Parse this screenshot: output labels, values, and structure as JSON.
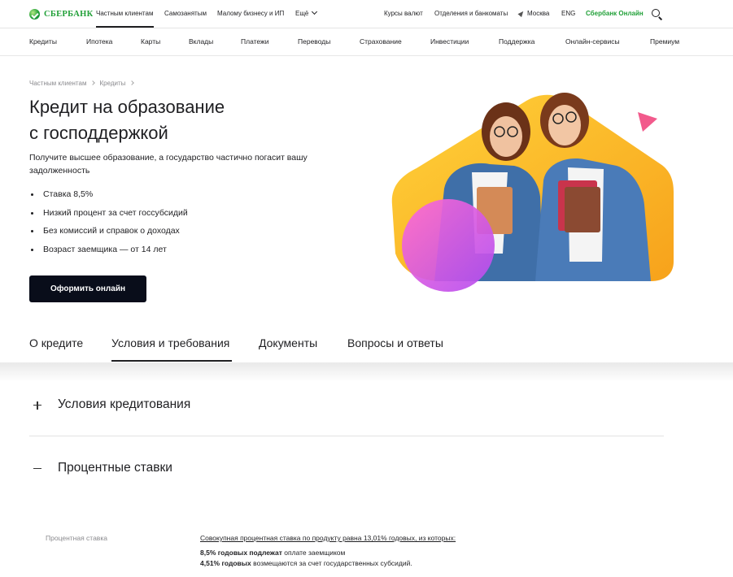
{
  "header": {
    "logo": "СБЕРБАНК",
    "segments": [
      "Частным клиентам",
      "Самозанятым",
      "Малому бизнесу и ИП",
      "Ещё"
    ],
    "links": [
      "Курсы валют",
      "Отделения и банкоматы",
      "Москва",
      "ENG",
      "Сбербанк Онлайн"
    ],
    "accent": "#21a038"
  },
  "subnav": [
    "Кредиты",
    "Ипотека",
    "Карты",
    "Вклады",
    "Платежи",
    "Переводы",
    "Страхование",
    "Инвестиции",
    "Поддержка",
    "Онлайн-сервисы",
    "Премиум"
  ],
  "breadcrumbs": [
    "Частным клиентам",
    "Кредиты"
  ],
  "hero": {
    "title_line1": "Кредит на образование",
    "title_line2": "с господдержкой",
    "lead": "Получите высшее образование, а государство частично погасит вашу задолженность",
    "bullets": [
      "Ставка 8,5%",
      "Низкий процент за счет госсубсидий",
      "Без комиссий и справок о доходах",
      "Возраст заемщика — от 14 лет"
    ],
    "cta": "Оформить онлайн"
  },
  "tabs": [
    "О кредите",
    "Условия и требования",
    "Документы",
    "Вопросы и ответы"
  ],
  "accordion": {
    "section1": "Условия кредитования",
    "section2": "Процентные ставки"
  },
  "rates": {
    "label": "Процентная ставка",
    "summary": "Совокупная процентная ставка по продукту  равна 13,01% годовых, из которых:",
    "line1_bold": "8,5% годовых подлежат",
    "line1_rest": " оплате  заемщиком",
    "line2_bold": "4,51% годовых",
    "line2_rest": " возмещаются за счет государственных субсидий."
  }
}
